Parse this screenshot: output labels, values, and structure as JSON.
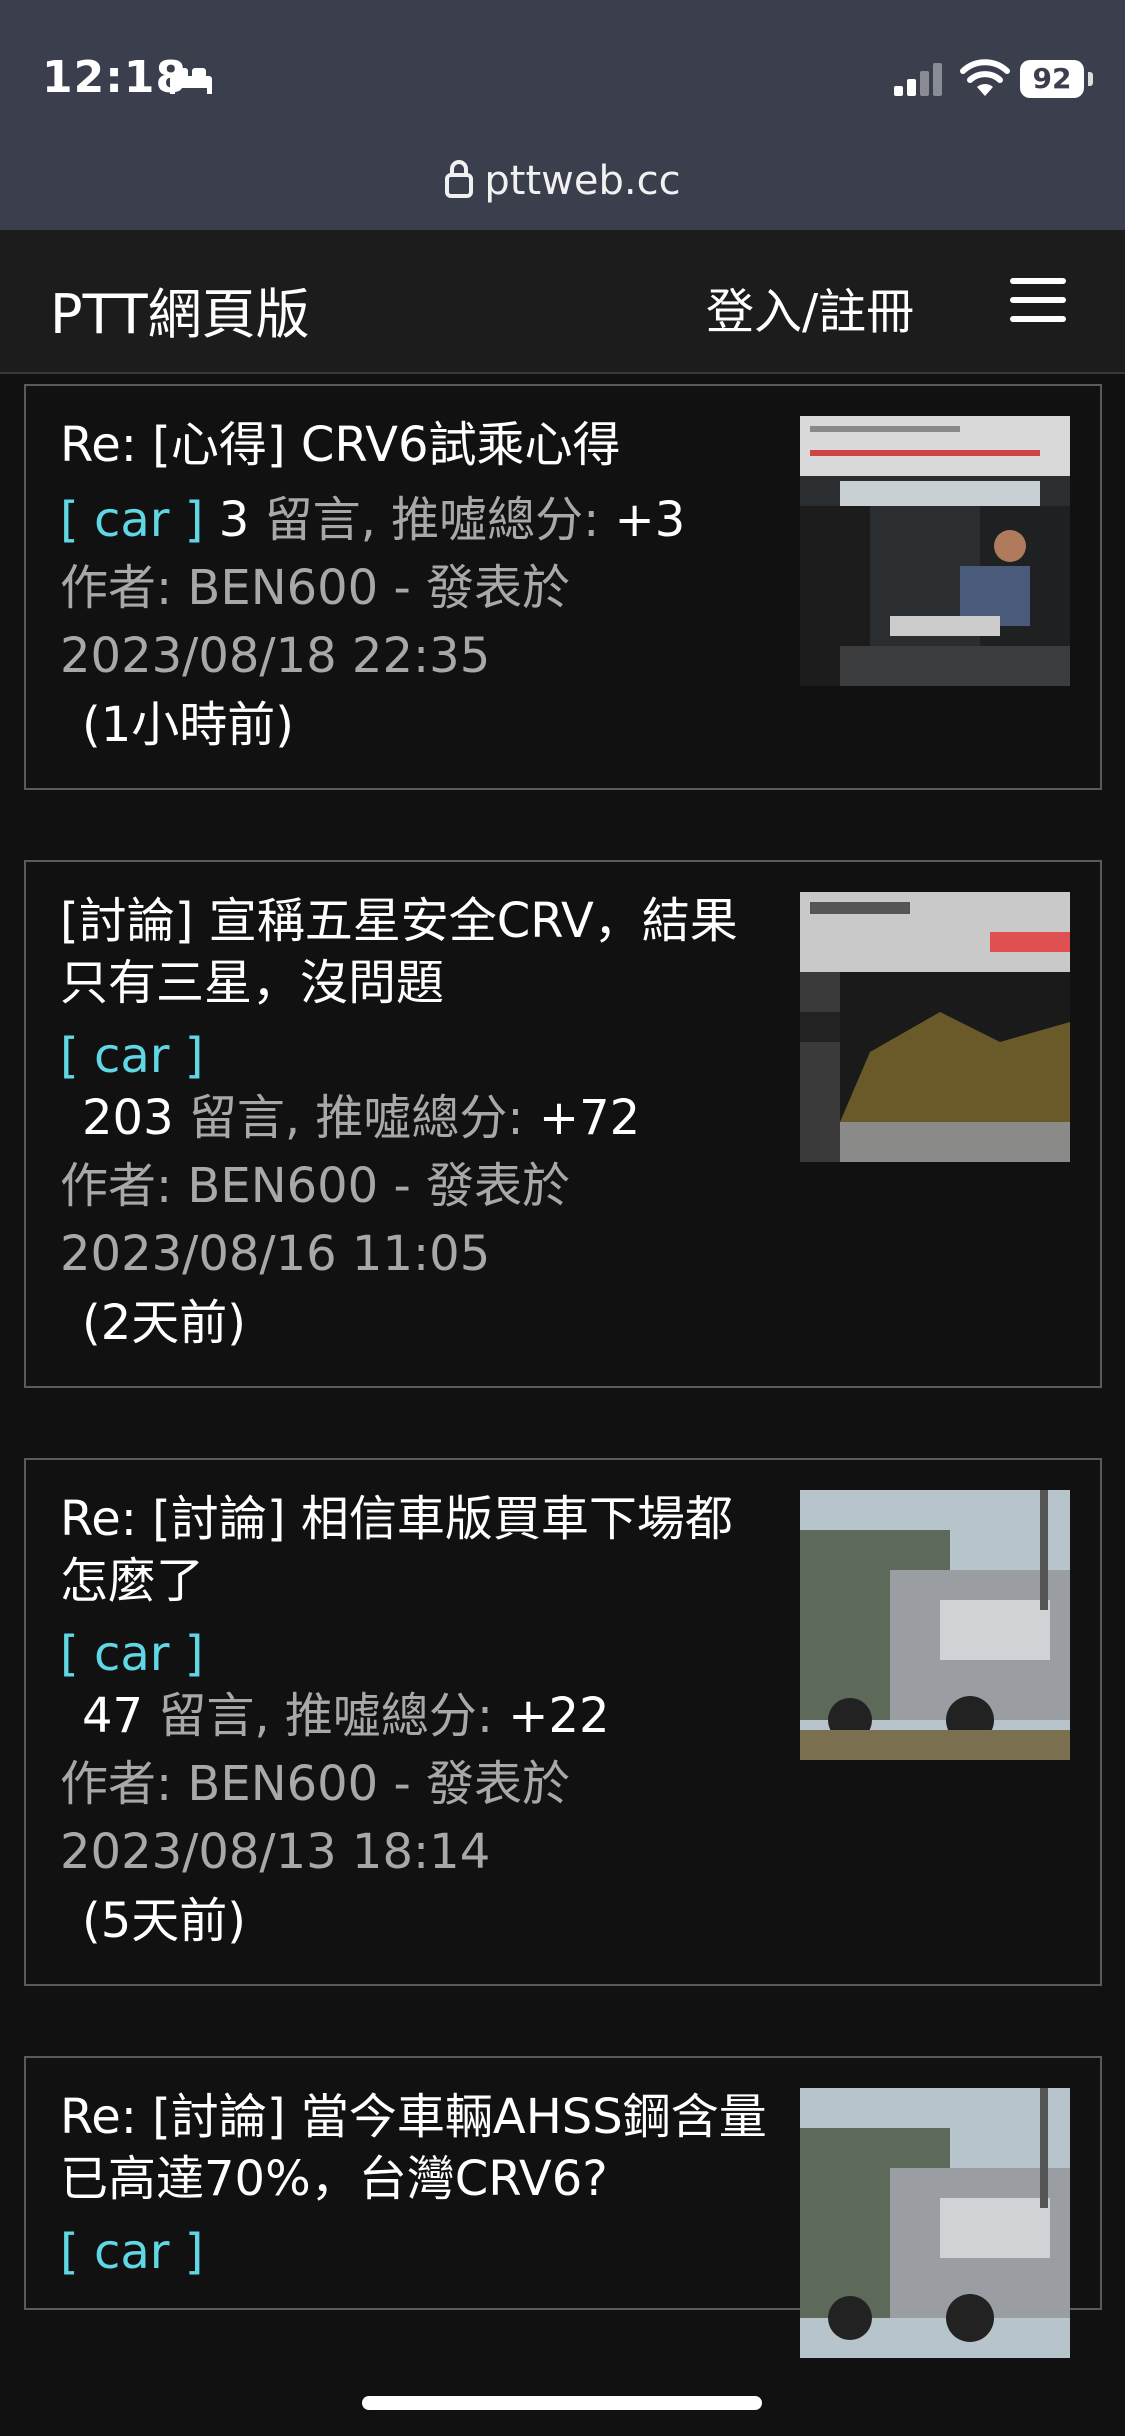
{
  "status_bar": {
    "time": "12:18",
    "battery": "92"
  },
  "browser": {
    "url": "pttweb.cc"
  },
  "header": {
    "brand": "PTT網頁版",
    "login_label": "登入/註冊"
  },
  "posts": [
    {
      "title": "Re: [心得] CRV6試乘心得",
      "board": "[ car ]",
      "comments": "3",
      "stats_text": " 留言, 推噓總分: ",
      "score": "+3",
      "author_line": "作者: BEN600 - 發表於",
      "date": "2023/08/18 22:35",
      "ago": "(1小時前)"
    },
    {
      "title": "[討論] 宣稱五星安全CRV，結果只有三星，沒問題",
      "board": "[ car ]",
      "comments": "203",
      "stats_text": " 留言, 推噓總分: ",
      "score": "+72",
      "author_line": "作者: BEN600 - 發表於",
      "date": "2023/08/16 11:05",
      "ago": "(2天前)"
    },
    {
      "title": "Re: [討論] 相信車版買車下場都怎麼了",
      "board": "[ car ]",
      "comments": "47",
      "stats_text": " 留言, 推噓總分: ",
      "score": "+22",
      "author_line": "作者: BEN600 - 發表於",
      "date": "2023/08/13 18:14",
      "ago": "(5天前)"
    },
    {
      "title": "Re: [討論] 當今車輛AHSS鋼含量已高達70%，台灣CRV6?",
      "board": "[ car ]"
    }
  ],
  "colors": {
    "board": "#5fd7e4",
    "background": "#111111",
    "status_bg": "#3b3e4c"
  }
}
